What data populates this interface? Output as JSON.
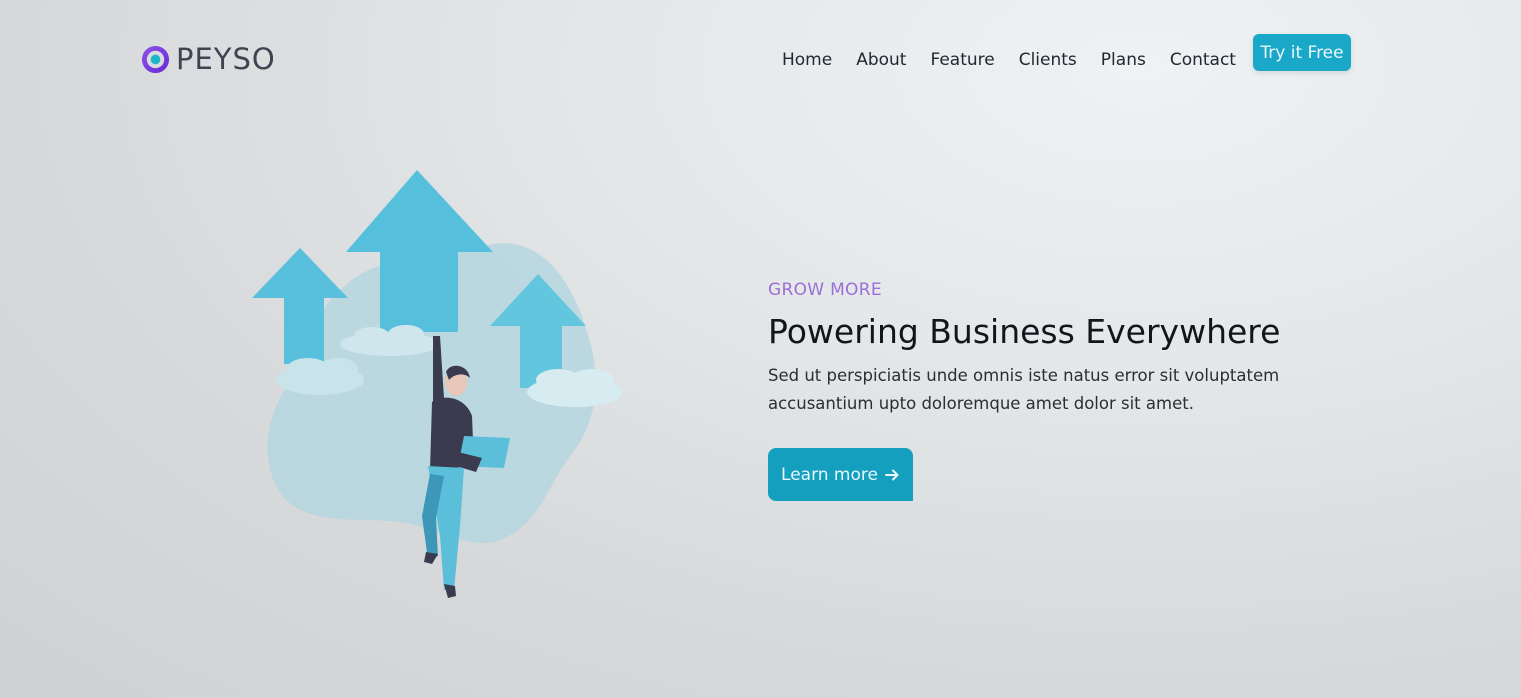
{
  "brand": {
    "name": "PEYSO",
    "logo_icon": "ring-dot-logo-icon",
    "colors": {
      "ring": "#7c3fe0",
      "dot": "#1fb5c9",
      "text": "#3f4450"
    }
  },
  "nav": {
    "items": [
      {
        "label": "Home"
      },
      {
        "label": "About"
      },
      {
        "label": "Feature"
      },
      {
        "label": "Clients"
      },
      {
        "label": "Plans"
      },
      {
        "label": "Contact"
      }
    ],
    "cta_label": "Try it Free"
  },
  "hero": {
    "eyebrow": "GROW MORE",
    "title": "Powering Business Everywhere",
    "description": "Sed ut perspiciatis unde omnis iste natus error sit voluptatem accusantium upto doloremque amet dolor sit amet.",
    "button_label": "Learn more",
    "button_icon": "arrow-right-icon",
    "illustration": "growth-arrows-person-laptop-illustration"
  },
  "colors": {
    "accent": "#1aa8c9",
    "eyebrow": "#9b6fd6",
    "heading": "#12161c"
  }
}
